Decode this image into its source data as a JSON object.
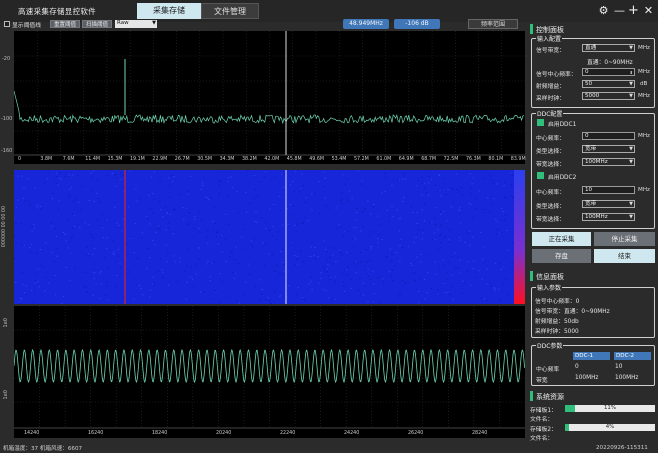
{
  "window": {
    "title": "高速采集存储显控软件",
    "tabs": [
      {
        "label": "采集存储",
        "active": true
      },
      {
        "label": "文件管理",
        "active": false
      }
    ],
    "controls": {
      "settings": "⚙",
      "minimize": "—",
      "maximize": "+",
      "close": "✕"
    }
  },
  "toolbar": {
    "threshold_checkbox_label": "显示阈值线",
    "reset_threshold_label": "重置阈值",
    "scan_threshold_label": "扫描阈值",
    "mode_select_value": "Raw",
    "frequency_readout": "48.949MHz",
    "level_readout": "-106 dB",
    "range_button_label": "频率范围"
  },
  "spectrum": {
    "y_ticks": [
      "-20",
      "-100",
      "-160"
    ],
    "x_ticks": [
      "0",
      "3.8M",
      "7.6M",
      "11.4M",
      "15.3M",
      "19.1M",
      "22.9M",
      "26.7M",
      "30.5M",
      "34.3M",
      "38.2M",
      "42.0M",
      "45.8M",
      "49.6M",
      "53.4M",
      "57.2M",
      "61.0M",
      "64.9M",
      "68.7M",
      "72.5M",
      "76.3M",
      "80.1M",
      "83.9M"
    ]
  },
  "waterfall": {
    "y_label": "000000 00 00 00"
  },
  "waveform": {
    "y_ticks": [
      "1e0",
      "1e0"
    ],
    "x_ticks": [
      "14240",
      "16240",
      "18240",
      "20240",
      "22240",
      "24240",
      "26240",
      "28240"
    ]
  },
  "status": {
    "left": "机箱温度：37 机箱风速：6607",
    "right": "20220926-115311"
  },
  "control_panel": {
    "title": "控制面板",
    "input_config": {
      "title": "输入配置",
      "bandwidth_label": "信号带宽：",
      "bandwidth_value": "直通",
      "bandwidth_unit": "MHz",
      "bandwidth_note": "直通：0~90MHz",
      "center_freq_label": "信号中心频率：",
      "center_freq_value": "0",
      "center_freq_unit": "MHz",
      "gain_label": "射频增益：",
      "gain_value": "50",
      "gain_unit": "dB",
      "clock_label": "采样时钟：",
      "clock_value": "5000",
      "clock_unit": "MHz"
    },
    "ddc_config": {
      "title": "DDC配置",
      "ddc1": {
        "enable_label": "启用DDC1",
        "center_label": "中心频率：",
        "center_value": "0",
        "center_unit": "MHz",
        "type_label": "类型选择：",
        "type_value": "宽带",
        "bw_label": "带宽选择：",
        "bw_value": "100MHz"
      },
      "ddc2": {
        "enable_label": "启用DDC2",
        "center_label": "中心频率：",
        "center_value": "10",
        "center_unit": "MHz",
        "type_label": "类型选择：",
        "type_value": "宽带",
        "bw_label": "带宽选择：",
        "bw_value": "100MHz"
      }
    },
    "buttons": {
      "acquiring": "正在采集",
      "stop": "停止采集",
      "save": "存盘",
      "end": "结束"
    }
  },
  "info_panel": {
    "title": "信息面板",
    "input_params": {
      "title": "输入参数",
      "lines": [
        "信号中心频率：0",
        "信号带宽：直通：0~90MHz",
        "射频增益：50db",
        "采样时钟：5000"
      ]
    },
    "ddc_params": {
      "title": "DDC参数",
      "headers": [
        "DDC-1",
        "DDC-2"
      ],
      "rows": [
        {
          "label": "中心频率",
          "ddc1": "0",
          "ddc2": "10"
        },
        {
          "label": "带宽",
          "ddc1": "100MHz",
          "ddc2": "100MHz"
        }
      ]
    }
  },
  "system_resources": {
    "title": "系统资源",
    "storage1_label": "存储板1：",
    "storage1_percent": "11%",
    "storage1_fraction": 0.11,
    "storage1_file": "文件名：",
    "storage2_label": "存储板2：",
    "storage2_percent": "4%",
    "storage2_fraction": 0.04,
    "storage2_file": "文件名："
  },
  "colors": {
    "accent_green": "#2fbf7a",
    "accent_blue": "#3f77b8",
    "trace_green": "#6fd6b0",
    "waterfall_blue": "#1726d8",
    "tab_active": "#cfe8ef"
  }
}
